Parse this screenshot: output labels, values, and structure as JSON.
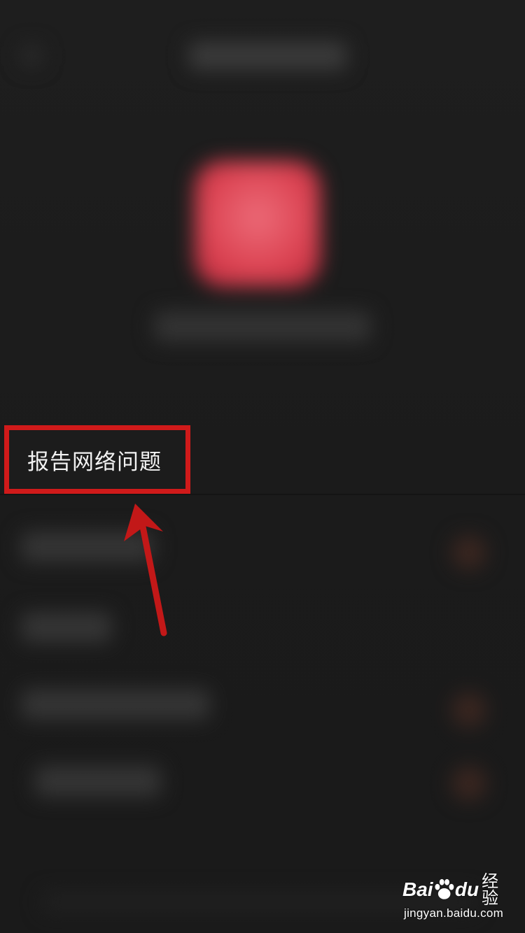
{
  "menu": {
    "report_network_issue_label": "报告网络问题"
  },
  "watermark": {
    "brand_prefix": "Bai",
    "brand_suffix": "du",
    "product": "经验",
    "url": "jingyan.baidu.com"
  },
  "colors": {
    "background": "#1c1c1c",
    "highlight_red": "#d01a1a",
    "app_icon_red": "#dc4453",
    "label_text": "#f2f2f2"
  },
  "icons": {
    "app_icon": "app-icon",
    "annotation_arrow": "arrow-icon",
    "brand_paw": "paw-icon"
  }
}
